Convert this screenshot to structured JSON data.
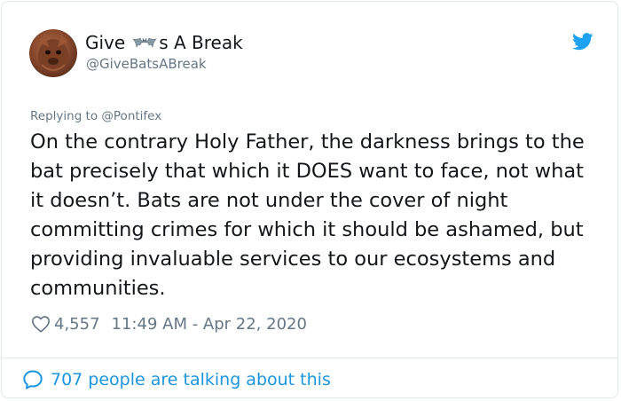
{
  "tweet": {
    "display_name_before": "Give",
    "display_name_emoji": "bat-emoji",
    "display_name_after": "s A Break",
    "handle": "@GiveBatsABreak",
    "reply_to": "Replying to @Pontifex",
    "text": "On the contrary Holy Father, the darkness brings to the bat precisely that which it DOES want to face, not what it doesn’t. Bats are not under the cover of night committing crimes for which it should be ashamed, but providing invaluable services to our ecosystems and communities.",
    "likes": "4,557",
    "timestamp": "11:49 AM - Apr 22, 2020",
    "talking": "707 people are talking about this"
  },
  "icons": {
    "avatar": "avatar-image",
    "brand": "twitter-bird-icon",
    "like": "heart-icon",
    "conversation": "speech-bubble-icon"
  },
  "colors": {
    "text": "#14171a",
    "secondary": "#657786",
    "accent": "#1b95e0",
    "twitter_blue": "#1da1f2",
    "border": "#e1e8ed"
  }
}
